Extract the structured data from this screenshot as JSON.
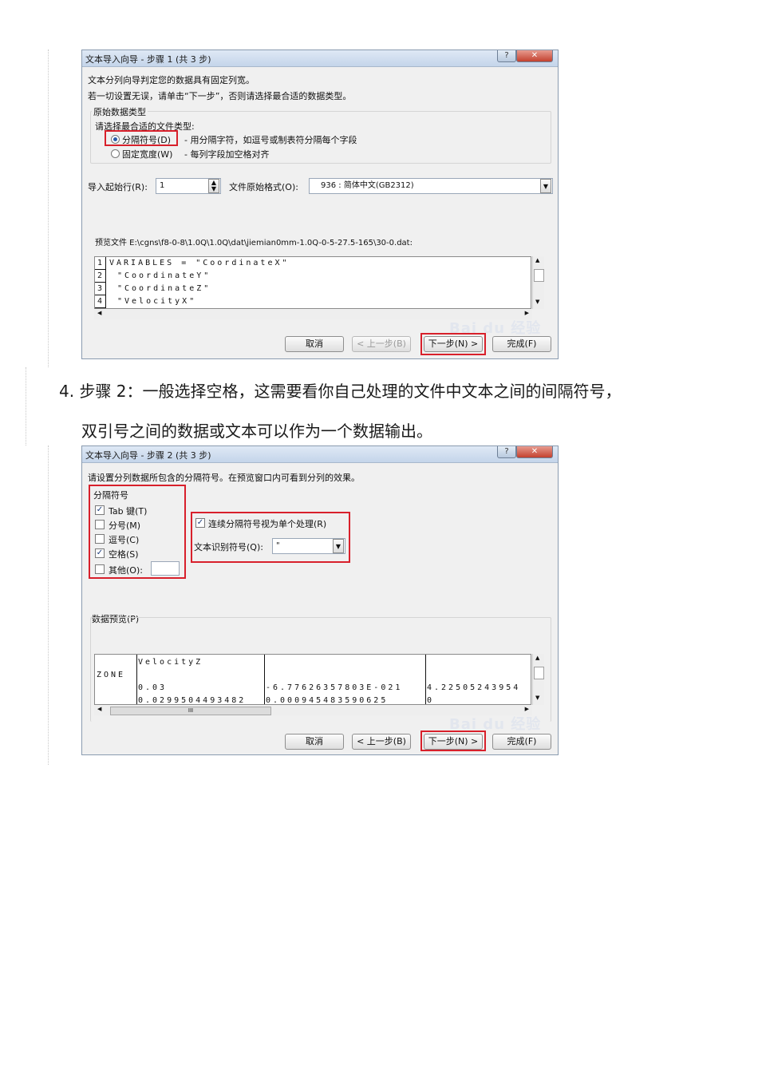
{
  "dialog1": {
    "title": "文本导入向导 - 步骤 1 (共 3 步)",
    "desc_line1": "文本分列向导判定您的数据具有固定列宽。",
    "desc_line2": "若一切设置无误，请单击“下一步”，否则请选择最合适的数据类型。",
    "group_label": "原始数据类型",
    "choose_label": "请选择最合适的文件类型:",
    "radio_delimited_label": "分隔符号(D)",
    "radio_delimited_desc": "- 用分隔字符，如逗号或制表符分隔每个字段",
    "radio_fixed_label": "固定宽度(W)",
    "radio_fixed_desc": "- 每列字段加空格对齐",
    "start_row_label": "导入起始行(R):",
    "start_row_value": "1",
    "origin_label": "文件原始格式(O):",
    "origin_value": "936 : 简体中文(GB2312)",
    "preview_label": "预览文件 E:\\cgns\\f8-0-8\\1.0Q\\1.0Q\\dat\\jiemian0mm-1.0Q-0-5-27.5-165\\30-0.dat:",
    "preview_rows": [
      {
        "num": "1",
        "text": "VARIABLES = \"CoordinateX\""
      },
      {
        "num": "2",
        "text": "\"CoordinateY\""
      },
      {
        "num": "3",
        "text": "\"CoordinateZ\""
      },
      {
        "num": "4",
        "text": "\"VelocityX\""
      }
    ],
    "buttons": {
      "cancel": "取消",
      "back": "< 上一步(B)",
      "next": "下一步(N) >",
      "finish": "完成(F)"
    }
  },
  "step4": {
    "line1": "4. 步骤 2：一般选择空格，这需要看你自己处理的文件中文本之间的间隔符号，",
    "line2": "双引号之间的数据或文本可以作为一个数据输出。"
  },
  "dialog2": {
    "title": "文本导入向导 - 步骤 2 (共 3 步)",
    "desc": "请设置分列数据所包含的分隔符号。在预览窗口内可看到分列的效果。",
    "delim_group_label": "分隔符号",
    "delimiters": [
      {
        "label": "Tab 键(T)",
        "checked": true
      },
      {
        "label": "分号(M)",
        "checked": false
      },
      {
        "label": "逗号(C)",
        "checked": false
      },
      {
        "label": "空格(S)",
        "checked": true
      },
      {
        "label": "其他(O):",
        "checked": false
      }
    ],
    "consecutive_label": "连续分隔符号视为单个处理(R)",
    "consecutive_checked": true,
    "qualifier_label": "文本识别符号(Q):",
    "qualifier_value": "\"",
    "preview_label": "数据预览(P)",
    "preview_col1": [
      "",
      "ZONE",
      "",
      ""
    ],
    "preview_col2": [
      "VelocityZ",
      "",
      "0.03",
      "0.0299504493482"
    ],
    "preview_col3": [
      "",
      "",
      "-6.77626357803E-021",
      "0.000945483590625"
    ],
    "preview_col4": [
      "",
      "",
      "4.22505243954",
      "0"
    ],
    "scroll_thumb": "III",
    "buttons": {
      "cancel": "取消",
      "back": "< 上一步(B)",
      "next": "下一步(N) >",
      "finish": "完成(F)"
    }
  },
  "watermark": "Bai du 经验",
  "colors": {
    "highlight": "#d8202b",
    "dialog_bg": "#f0f0f0",
    "titlebar": "#c4d5ea"
  }
}
